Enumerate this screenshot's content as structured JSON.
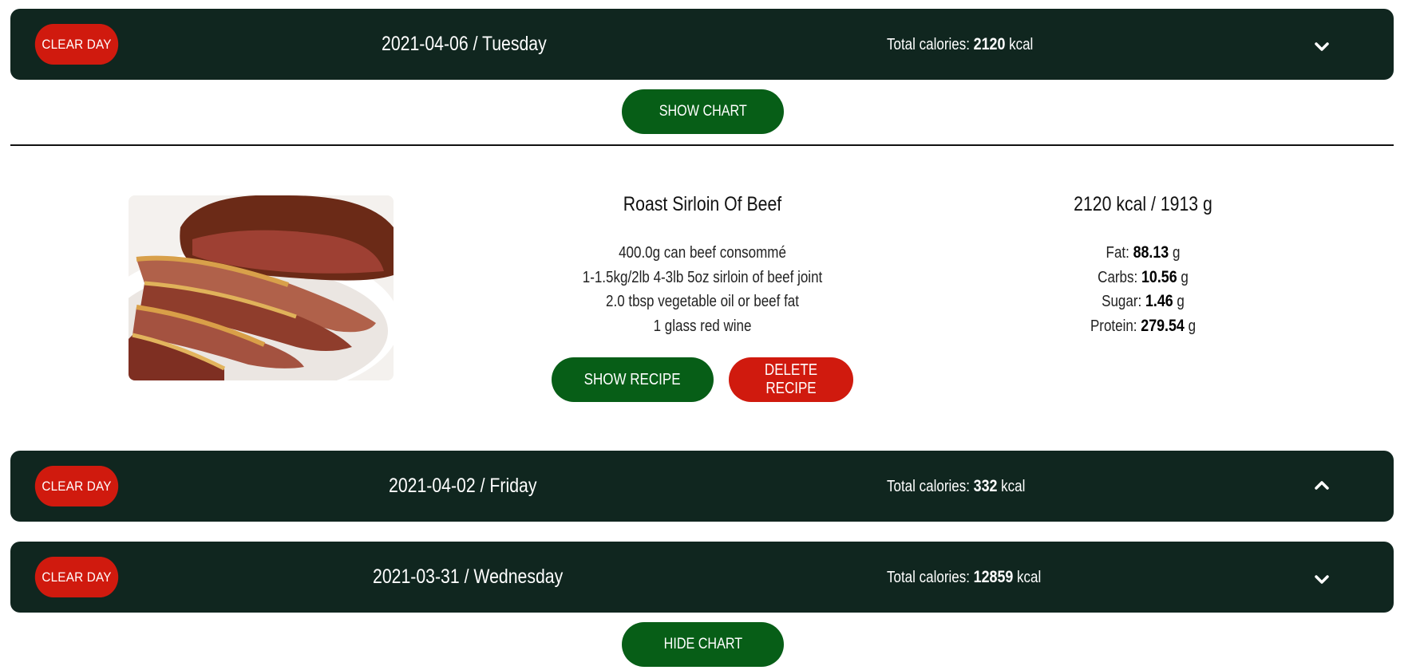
{
  "days": [
    {
      "clear_label": "CLEAR DAY",
      "date": "2021-04-06 / Tuesday",
      "calories_label": "Total calories:",
      "calories_value": "2120",
      "calories_unit": "kcal",
      "toggle_icon": "chevron-down-icon",
      "chart_label": "SHOW CHART"
    },
    {
      "clear_label": "CLEAR DAY",
      "date": "2021-04-02 / Friday",
      "calories_label": "Total calories:",
      "calories_value": "332",
      "calories_unit": "kcal",
      "toggle_icon": "chevron-up-icon"
    },
    {
      "clear_label": "CLEAR DAY",
      "date": "2021-03-31 / Wednesday",
      "calories_label": "Total calories:",
      "calories_value": "12859",
      "calories_unit": "kcal",
      "toggle_icon": "chevron-down-icon",
      "chart_label": "HIDE CHART"
    }
  ],
  "recipe": {
    "image_icon": "roast-beef-photo",
    "title": "Roast Sirloin Of Beef",
    "ingredients": [
      "400.0g can beef consommé",
      "1-1.5kg/2lb 4-3lb 5oz sirloin of beef joint",
      "2.0 tbsp vegetable oil or beef fat",
      "1 glass red wine"
    ],
    "show_label": "SHOW RECIPE",
    "delete_label": "DELETE RECIPE",
    "totals": "2120 kcal / 1913 g",
    "nutrients": [
      {
        "label": "Fat:",
        "value": "88.13",
        "unit": "g"
      },
      {
        "label": "Carbs:",
        "value": "10.56",
        "unit": "g"
      },
      {
        "label": "Sugar:",
        "value": "1.46",
        "unit": "g"
      },
      {
        "label": "Protein:",
        "value": "279.54",
        "unit": "g"
      }
    ]
  },
  "colors": {
    "bar_bg": "#10261f",
    "clear_red": "#d01a0e",
    "button_green": "#075e17"
  }
}
